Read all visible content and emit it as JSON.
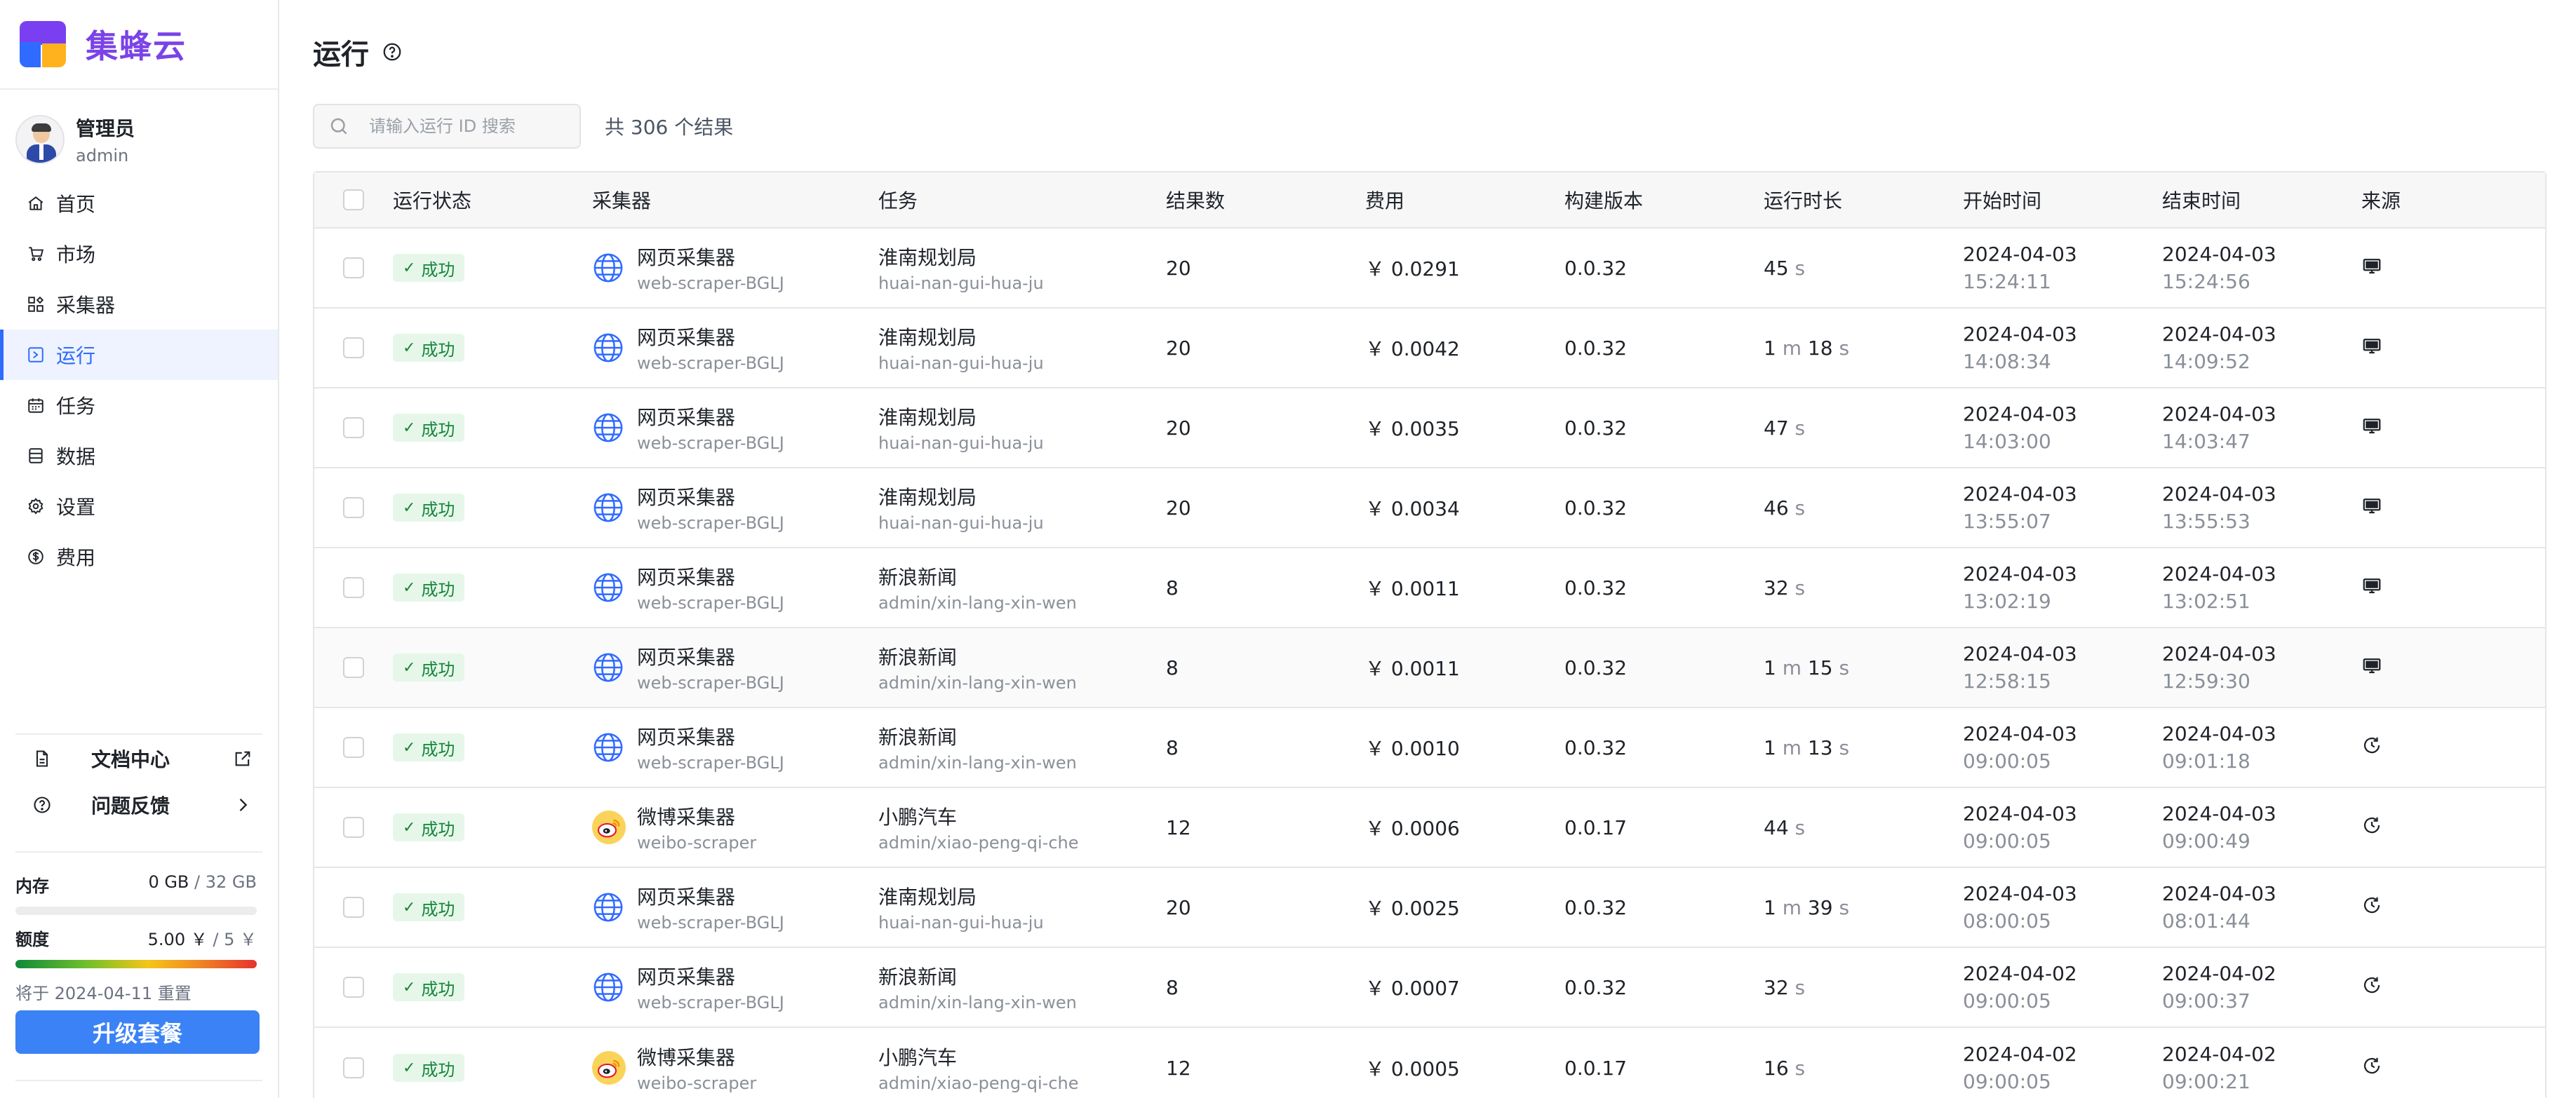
{
  "app": {
    "name": "集蜂云"
  },
  "user": {
    "name": "管理员",
    "handle": "admin"
  },
  "nav": [
    {
      "label": "首页",
      "icon": "home-icon",
      "active": false
    },
    {
      "label": "市场",
      "icon": "cart-icon",
      "active": false
    },
    {
      "label": "采集器",
      "icon": "apps-icon",
      "active": false
    },
    {
      "label": "运行",
      "icon": "run-icon",
      "active": true
    },
    {
      "label": "任务",
      "icon": "calendar-icon",
      "active": false
    },
    {
      "label": "数据",
      "icon": "database-icon",
      "active": false
    },
    {
      "label": "设置",
      "icon": "gear-icon",
      "active": false
    },
    {
      "label": "费用",
      "icon": "dollar-icon",
      "active": false
    }
  ],
  "sidebar_links": {
    "docs": "文档中心",
    "feedback": "问题反馈"
  },
  "usage": {
    "memory_label": "内存",
    "memory_used": "0 GB",
    "memory_total": "/ 32 GB",
    "memory_fraction": 0,
    "quota_label": "额度",
    "quota_used": "5.00 ￥",
    "quota_total": "/ 5 ￥",
    "quota_fraction": 1,
    "reset_note": "将于 2024-04-11 重置",
    "upgrade_label": "升级套餐"
  },
  "page": {
    "title": "运行",
    "search_placeholder": "请输入运行 ID 搜索",
    "result_count": "共 306 个结果"
  },
  "colors": {
    "accent": "#2f6bff",
    "brand": "#7b43e6",
    "success": "#16853b",
    "upgrade": "#3b82f6"
  },
  "table": {
    "headers": [
      "运行状态",
      "采集器",
      "任务",
      "结果数",
      "费用",
      "构建版本",
      "运行时长",
      "开始时间",
      "结束时间",
      "来源"
    ],
    "rows": [
      {
        "status": "成功",
        "scraper": "网页采集器",
        "scraper_id": "web-scraper-BGLJ",
        "scraper_icon": "globe-icon",
        "task": "淮南规划局",
        "task_id": "huai-nan-gui-hua-ju",
        "count": "20",
        "cost": "￥ 0.0291",
        "version": "0.0.32",
        "dur_m": "",
        "dur_s": "45",
        "start_date": "2024-04-03",
        "start_time": "15:24:11",
        "end_date": "2024-04-03",
        "end_time": "15:24:56",
        "source": "monitor-icon"
      },
      {
        "status": "成功",
        "scraper": "网页采集器",
        "scraper_id": "web-scraper-BGLJ",
        "scraper_icon": "globe-icon",
        "task": "淮南规划局",
        "task_id": "huai-nan-gui-hua-ju",
        "count": "20",
        "cost": "￥ 0.0042",
        "version": "0.0.32",
        "dur_m": "1",
        "dur_s": "18",
        "start_date": "2024-04-03",
        "start_time": "14:08:34",
        "end_date": "2024-04-03",
        "end_time": "14:09:52",
        "source": "monitor-icon"
      },
      {
        "status": "成功",
        "scraper": "网页采集器",
        "scraper_id": "web-scraper-BGLJ",
        "scraper_icon": "globe-icon",
        "task": "淮南规划局",
        "task_id": "huai-nan-gui-hua-ju",
        "count": "20",
        "cost": "￥ 0.0035",
        "version": "0.0.32",
        "dur_m": "",
        "dur_s": "47",
        "start_date": "2024-04-03",
        "start_time": "14:03:00",
        "end_date": "2024-04-03",
        "end_time": "14:03:47",
        "source": "monitor-icon"
      },
      {
        "status": "成功",
        "scraper": "网页采集器",
        "scraper_id": "web-scraper-BGLJ",
        "scraper_icon": "globe-icon",
        "task": "淮南规划局",
        "task_id": "huai-nan-gui-hua-ju",
        "count": "20",
        "cost": "￥ 0.0034",
        "version": "0.0.32",
        "dur_m": "",
        "dur_s": "46",
        "start_date": "2024-04-03",
        "start_time": "13:55:07",
        "end_date": "2024-04-03",
        "end_time": "13:55:53",
        "source": "monitor-icon"
      },
      {
        "status": "成功",
        "scraper": "网页采集器",
        "scraper_id": "web-scraper-BGLJ",
        "scraper_icon": "globe-icon",
        "task": "新浪新闻",
        "task_id": "admin/xin-lang-xin-wen",
        "count": "8",
        "cost": "￥ 0.0011",
        "version": "0.0.32",
        "dur_m": "",
        "dur_s": "32",
        "start_date": "2024-04-03",
        "start_time": "13:02:19",
        "end_date": "2024-04-03",
        "end_time": "13:02:51",
        "source": "monitor-icon"
      },
      {
        "status": "成功",
        "scraper": "网页采集器",
        "scraper_id": "web-scraper-BGLJ",
        "scraper_icon": "globe-icon",
        "task": "新浪新闻",
        "task_id": "admin/xin-lang-xin-wen",
        "count": "8",
        "cost": "￥ 0.0011",
        "version": "0.0.32",
        "dur_m": "1",
        "dur_s": "15",
        "start_date": "2024-04-03",
        "start_time": "12:58:15",
        "end_date": "2024-04-03",
        "end_time": "12:59:30",
        "source": "monitor-icon"
      },
      {
        "status": "成功",
        "scraper": "网页采集器",
        "scraper_id": "web-scraper-BGLJ",
        "scraper_icon": "globe-icon",
        "task": "新浪新闻",
        "task_id": "admin/xin-lang-xin-wen",
        "count": "8",
        "cost": "￥ 0.0010",
        "version": "0.0.32",
        "dur_m": "1",
        "dur_s": "13",
        "start_date": "2024-04-03",
        "start_time": "09:00:05",
        "end_date": "2024-04-03",
        "end_time": "09:01:18",
        "source": "schedule-icon"
      },
      {
        "status": "成功",
        "scraper": "微博采集器",
        "scraper_id": "weibo-scraper",
        "scraper_icon": "weibo-icon",
        "task": "小鹏汽车",
        "task_id": "admin/xiao-peng-qi-che",
        "count": "12",
        "cost": "￥ 0.0006",
        "version": "0.0.17",
        "dur_m": "",
        "dur_s": "44",
        "start_date": "2024-04-03",
        "start_time": "09:00:05",
        "end_date": "2024-04-03",
        "end_time": "09:00:49",
        "source": "schedule-icon"
      },
      {
        "status": "成功",
        "scraper": "网页采集器",
        "scraper_id": "web-scraper-BGLJ",
        "scraper_icon": "globe-icon",
        "task": "淮南规划局",
        "task_id": "huai-nan-gui-hua-ju",
        "count": "20",
        "cost": "￥ 0.0025",
        "version": "0.0.32",
        "dur_m": "1",
        "dur_s": "39",
        "start_date": "2024-04-03",
        "start_time": "08:00:05",
        "end_date": "2024-04-03",
        "end_time": "08:01:44",
        "source": "schedule-icon"
      },
      {
        "status": "成功",
        "scraper": "网页采集器",
        "scraper_id": "web-scraper-BGLJ",
        "scraper_icon": "globe-icon",
        "task": "新浪新闻",
        "task_id": "admin/xin-lang-xin-wen",
        "count": "8",
        "cost": "￥ 0.0007",
        "version": "0.0.32",
        "dur_m": "",
        "dur_s": "32",
        "start_date": "2024-04-02",
        "start_time": "09:00:05",
        "end_date": "2024-04-02",
        "end_time": "09:00:37",
        "source": "schedule-icon"
      },
      {
        "status": "成功",
        "scraper": "微博采集器",
        "scraper_id": "weibo-scraper",
        "scraper_icon": "weibo-icon",
        "task": "小鹏汽车",
        "task_id": "admin/xiao-peng-qi-che",
        "count": "12",
        "cost": "￥ 0.0005",
        "version": "0.0.17",
        "dur_m": "",
        "dur_s": "16",
        "start_date": "2024-04-02",
        "start_time": "09:00:05",
        "end_date": "2024-04-02",
        "end_time": "09:00:21",
        "source": "schedule-icon"
      }
    ]
  }
}
